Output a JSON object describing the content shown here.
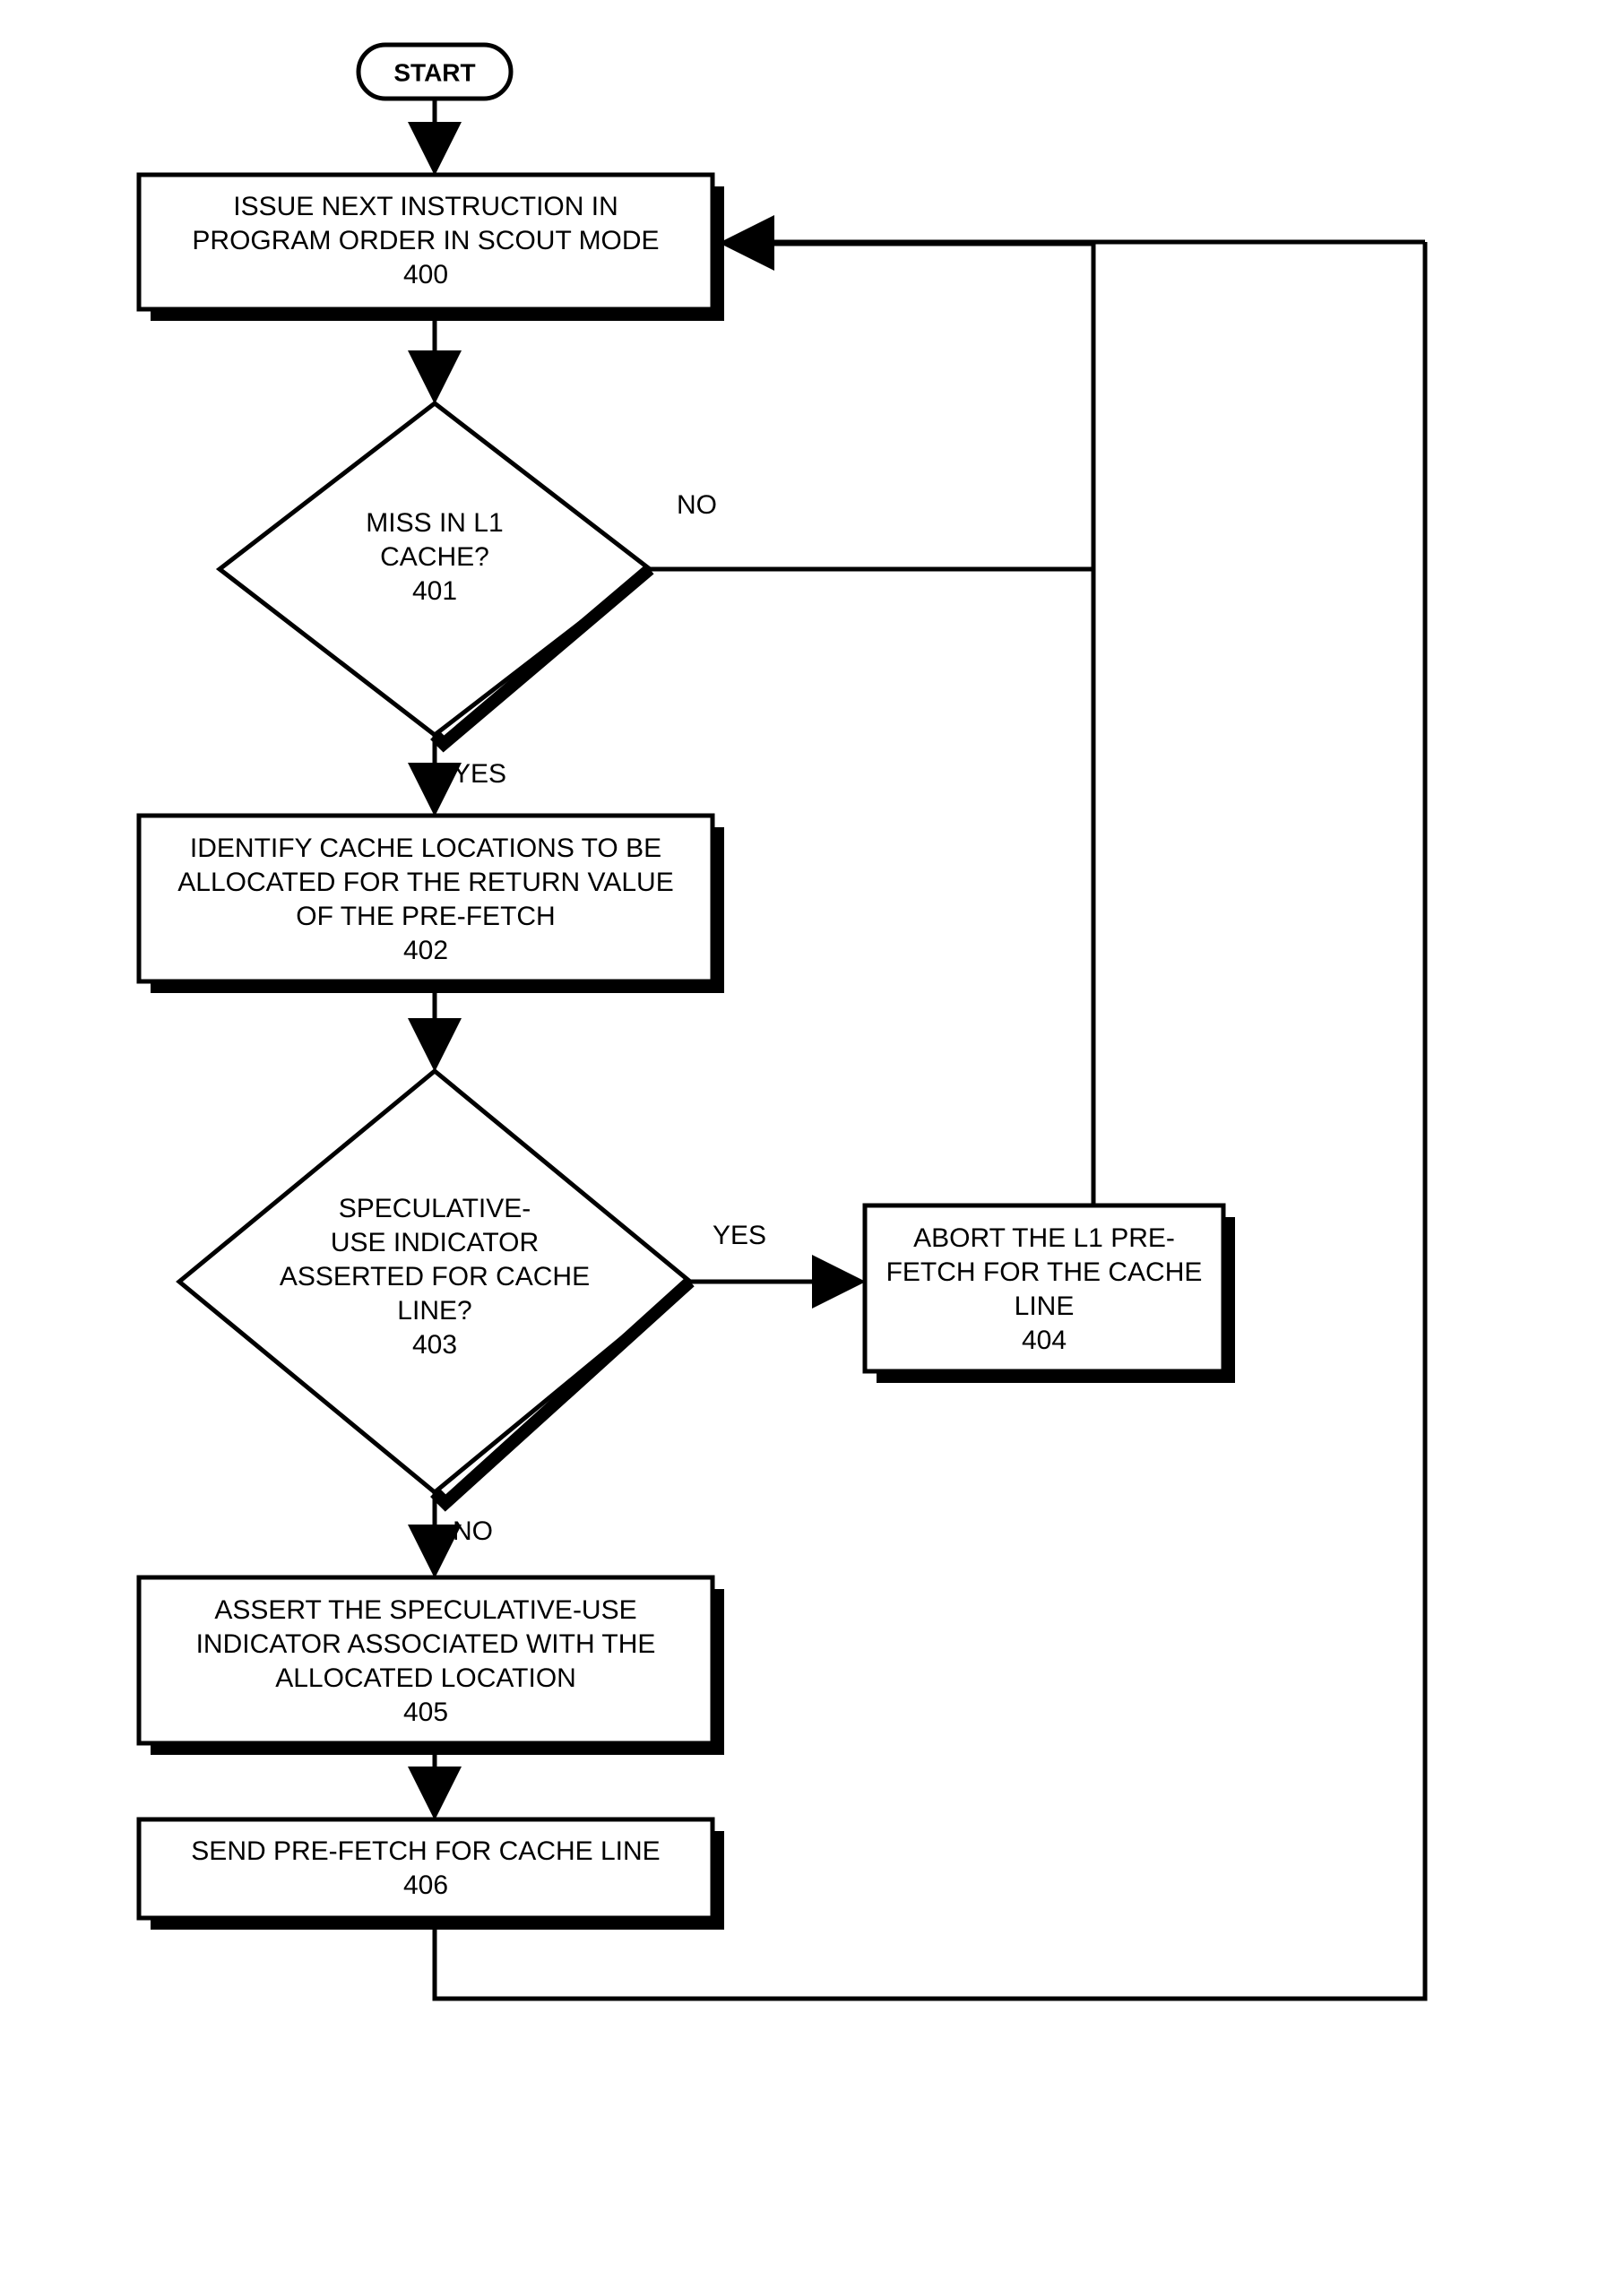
{
  "start": {
    "label": "START"
  },
  "nodes": {
    "n400": {
      "line1": "ISSUE NEXT INSTRUCTION IN",
      "line2": "PROGRAM ORDER IN SCOUT MODE",
      "ref": "400"
    },
    "n401": {
      "line1": "MISS IN L1",
      "line2": "CACHE?",
      "ref": "401"
    },
    "n402": {
      "line1": "IDENTIFY CACHE LOCATIONS TO BE",
      "line2": "ALLOCATED FOR THE RETURN VALUE",
      "line3": "OF THE PRE-FETCH",
      "ref": "402"
    },
    "n403": {
      "line1": "SPECULATIVE-",
      "line2": "USE INDICATOR",
      "line3": "ASSERTED FOR CACHE",
      "line4": "LINE?",
      "ref": "403"
    },
    "n404": {
      "line1": "ABORT THE L1 PRE-",
      "line2": "FETCH FOR THE CACHE",
      "line3": "LINE",
      "ref": "404"
    },
    "n405": {
      "line1": "ASSERT THE SPECULATIVE-USE",
      "line2": "INDICATOR ASSOCIATED WITH THE",
      "line3": "ALLOCATED LOCATION",
      "ref": "405"
    },
    "n406": {
      "line1": "SEND PRE-FETCH FOR CACHE LINE",
      "ref": "406"
    }
  },
  "edges": {
    "e401no": {
      "label": "NO"
    },
    "e401yes": {
      "label": "YES"
    },
    "e403yes": {
      "label": "YES"
    },
    "e403no": {
      "label": "NO"
    }
  }
}
